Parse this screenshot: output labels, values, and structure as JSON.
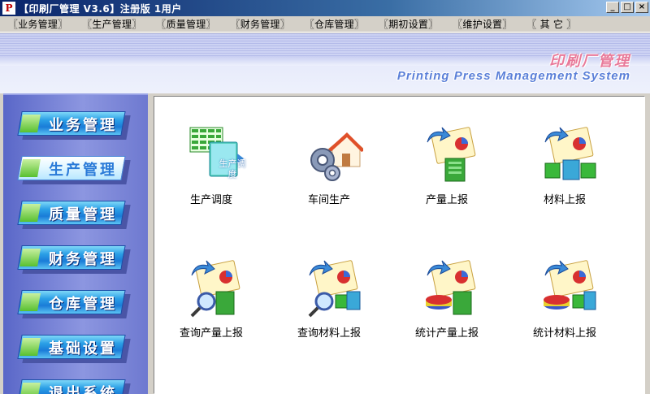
{
  "window": {
    "logo_glyph": "P",
    "title": "【印刷厂管理 V3.6】注册版 1用户",
    "buttons": {
      "minimize": "_",
      "maximize": "□",
      "close": "×"
    }
  },
  "menu": [
    "〖业务管理〗",
    "〖生产管理〗",
    "〖质量管理〗",
    "〖财务管理〗",
    "〖仓库管理〗",
    "〖期初设置〗",
    "〖维护设置〗",
    "〖 其 它 〗"
  ],
  "banner": {
    "title_cn": "印刷厂管理",
    "title_en": "Printing Press Management System"
  },
  "sidebar": {
    "active": "生产管理",
    "items": [
      "业务管理",
      "生产管理",
      "质量管理",
      "财务管理",
      "仓库管理",
      "基础设置",
      "退出系统"
    ]
  },
  "tiles": [
    {
      "label": "生产调度",
      "icon": "schedule-icon",
      "badge": "生产调度"
    },
    {
      "label": "车间生产",
      "icon": "workshop-icon"
    },
    {
      "label": "产量上报",
      "icon": "output-report-icon"
    },
    {
      "label": "材料上报",
      "icon": "material-report-icon"
    },
    {
      "label": "查询产量上报",
      "icon": "query-output-icon"
    },
    {
      "label": "查询材料上报",
      "icon": "query-material-icon"
    },
    {
      "label": "统计产量上报",
      "icon": "stat-output-icon"
    },
    {
      "label": "统计材料上报",
      "icon": "stat-material-icon"
    }
  ],
  "colors": {
    "titlebar": "#0a246a",
    "sidebar": "#7b86d8",
    "button_blue": "#1a7cd8",
    "banner_cn": "#e87a9a",
    "banner_en": "#5a7fd8"
  }
}
